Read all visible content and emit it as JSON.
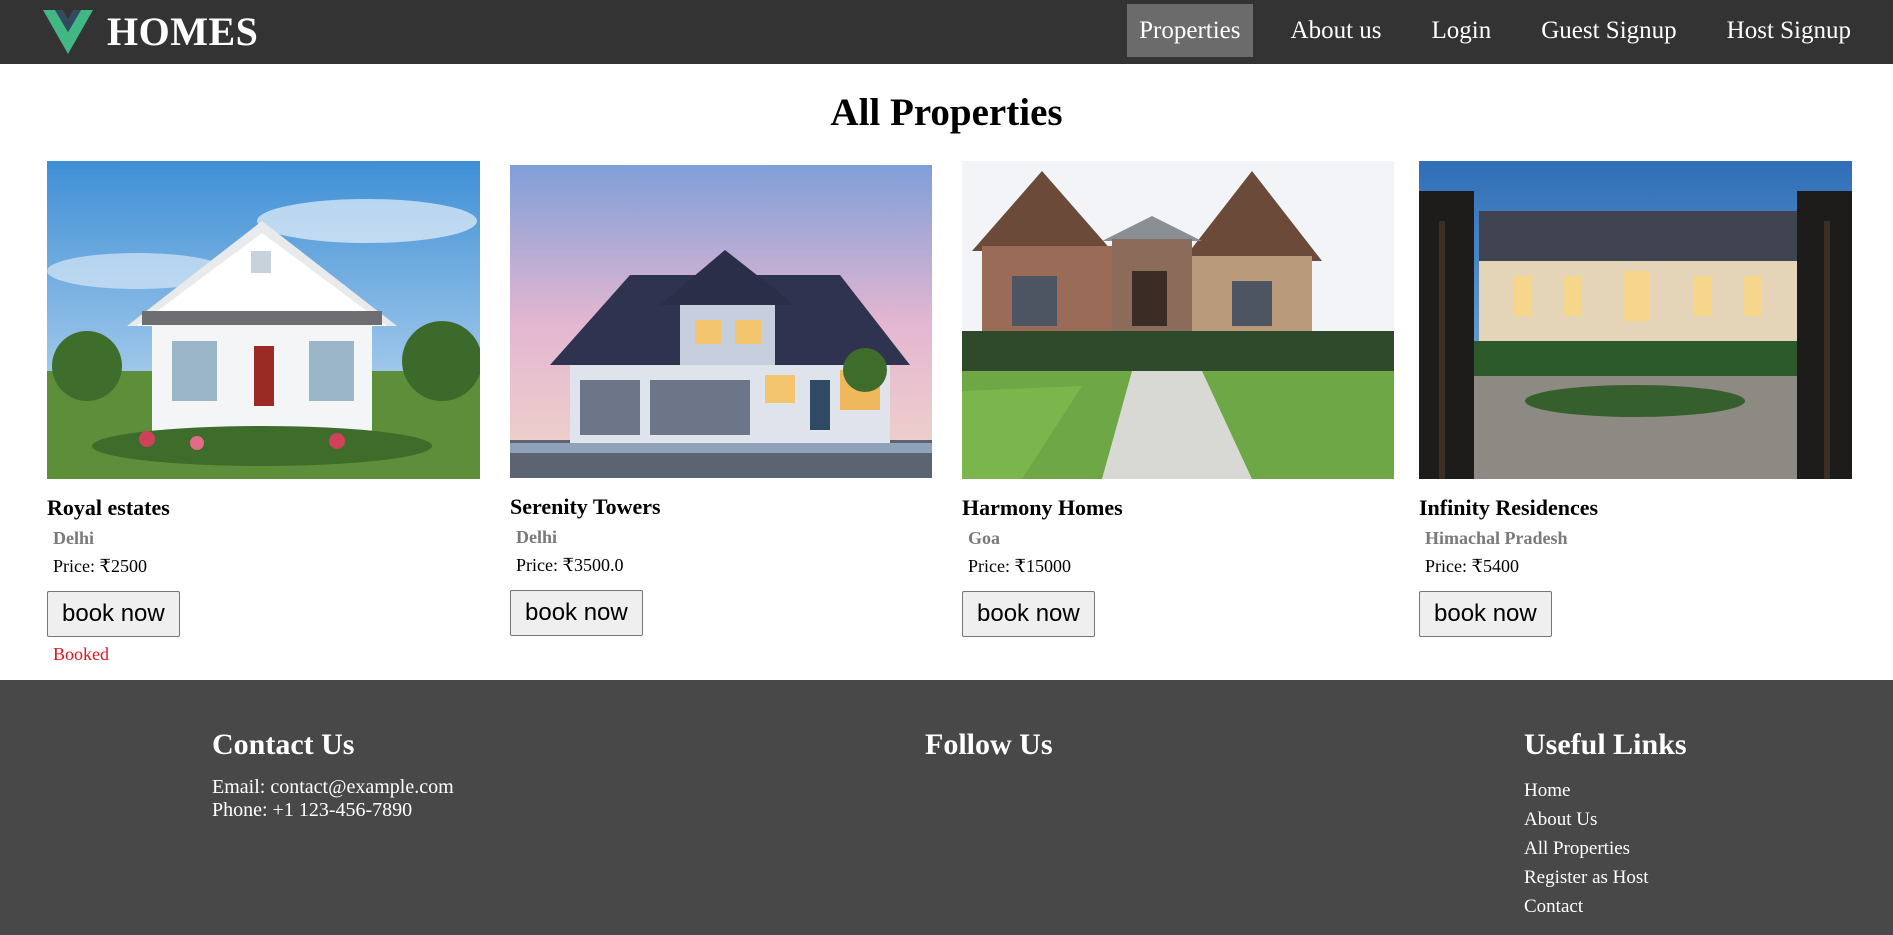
{
  "brand": {
    "name": "HOMES",
    "logo_icon": "vue-logo-icon",
    "logo_colors": [
      "#41b883",
      "#35495e"
    ]
  },
  "nav": {
    "items": [
      {
        "label": "Properties",
        "active": true
      },
      {
        "label": "About us",
        "active": false
      },
      {
        "label": "Login",
        "active": false
      },
      {
        "label": "Guest Signup",
        "active": false
      },
      {
        "label": "Host Signup",
        "active": false
      }
    ]
  },
  "main": {
    "title": "All Properties",
    "properties": [
      {
        "name": "Royal estates",
        "location": "Delhi",
        "price": "Price: ₹2500",
        "button": "book now",
        "status": "Booked",
        "image": "white-cottage-photo"
      },
      {
        "name": "Serenity Towers",
        "location": "Delhi",
        "price": "Price: ₹3500.0",
        "button": "book now",
        "status": "",
        "image": "suburban-house-dusk-photo"
      },
      {
        "name": "Harmony Homes",
        "location": "Goa",
        "price": "Price: ₹15000",
        "button": "book now",
        "status": "",
        "image": "brick-house-photo"
      },
      {
        "name": "Infinity Residences",
        "location": "Himachal Pradesh",
        "price": "Price: ₹5400",
        "button": "book now",
        "status": "",
        "image": "mansion-gates-photo"
      }
    ]
  },
  "footer": {
    "contact": {
      "heading": "Contact Us",
      "email": "Email: contact@example.com",
      "phone": "Phone: +1 123-456-7890"
    },
    "follow": {
      "heading": "Follow Us"
    },
    "links": {
      "heading": "Useful Links",
      "items": [
        "Home",
        "About Us",
        "All Properties",
        "Register as Host",
        "Contact"
      ]
    }
  },
  "colors": {
    "navbar_bg": "#333333",
    "nav_active_bg": "#6b6b6b",
    "footer_bg": "#484848",
    "booked_text": "#e0141e",
    "location_text": "#7a7a7a"
  }
}
